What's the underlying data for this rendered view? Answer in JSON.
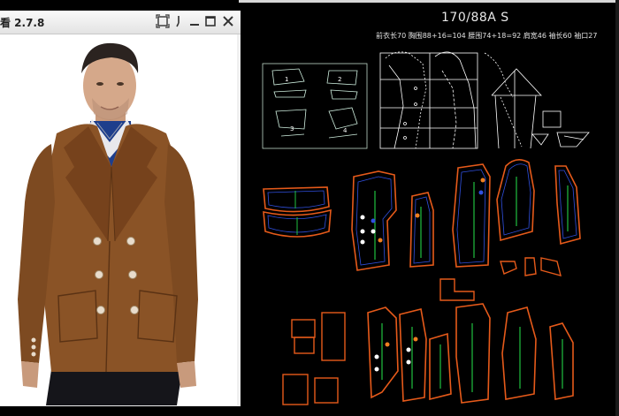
{
  "app": {
    "title": "看 2.7.8"
  },
  "window_controls": {
    "close_icon": "close-icon",
    "minimize_icon": "minimize-icon",
    "maximize_icon": "maximize-icon",
    "fit_icon": "fit-window-icon"
  },
  "pattern": {
    "size_title": "170/88A    S",
    "measurements": "前衣长70  胸围88+16=104  腰围74+18=92  肩宽46  袖长60  袖口27",
    "diagram_labels": [
      "1",
      "2",
      "3",
      "4"
    ]
  },
  "photo": {
    "subject": "man-in-brown-double-breasted-peacoat"
  },
  "colors": {
    "canvas": "#000000",
    "piece_outline": "#e65a1a",
    "inner_line": "#3050e0",
    "grain_line": "#20c040",
    "construction_line": "#ffffff",
    "coat": "#8a5326"
  }
}
